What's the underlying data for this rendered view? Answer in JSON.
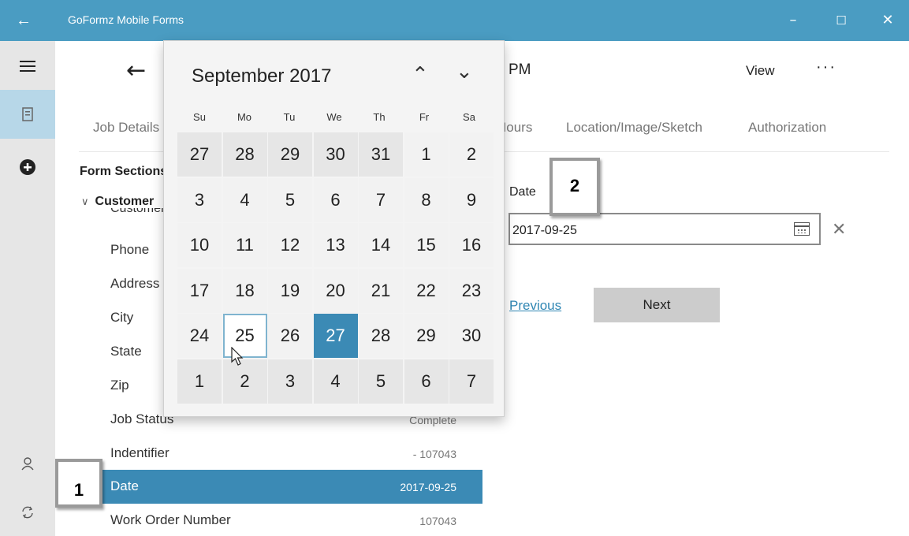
{
  "titlebar": {
    "title": "GoFormz Mobile Forms"
  },
  "header": {
    "title_partial": "PM",
    "view_label": "View",
    "more_label": "···"
  },
  "tabs": [
    "Job Details",
    "Hours",
    "Location/Image/Sketch",
    "Authorization"
  ],
  "sidebar": {
    "section_title": "Form Sections",
    "group_label": "Customer",
    "group_peek": "Customer"
  },
  "rows": [
    {
      "label": "Phone",
      "value": ""
    },
    {
      "label": "Address",
      "value": ""
    },
    {
      "label": "City",
      "value": ""
    },
    {
      "label": "State",
      "value": ""
    },
    {
      "label": "Zip",
      "value": ""
    },
    {
      "label": "Job Status",
      "value": "Complete"
    },
    {
      "label": "Indentifier",
      "value": "- 107043"
    },
    {
      "label": "Date",
      "value": "2017-09-25",
      "selected": true
    },
    {
      "label": "Work Order Number",
      "value": "107043"
    }
  ],
  "field": {
    "label": "Date",
    "value": "2017-09-25"
  },
  "buttons": {
    "previous": "Previous",
    "next": "Next"
  },
  "callouts": {
    "one": "1",
    "two": "2"
  },
  "calendar": {
    "month": "September 2017",
    "weekdays": [
      "Su",
      "Mo",
      "Tu",
      "We",
      "Th",
      "Fr",
      "Sa"
    ],
    "days": [
      {
        "d": "27",
        "out": true
      },
      {
        "d": "28",
        "out": true
      },
      {
        "d": "29",
        "out": true
      },
      {
        "d": "30",
        "out": true
      },
      {
        "d": "31",
        "out": true
      },
      {
        "d": "1"
      },
      {
        "d": "2"
      },
      {
        "d": "3"
      },
      {
        "d": "4"
      },
      {
        "d": "5"
      },
      {
        "d": "6"
      },
      {
        "d": "7"
      },
      {
        "d": "8"
      },
      {
        "d": "9"
      },
      {
        "d": "10"
      },
      {
        "d": "11"
      },
      {
        "d": "12"
      },
      {
        "d": "13"
      },
      {
        "d": "14"
      },
      {
        "d": "15"
      },
      {
        "d": "16"
      },
      {
        "d": "17"
      },
      {
        "d": "18"
      },
      {
        "d": "19"
      },
      {
        "d": "20"
      },
      {
        "d": "21"
      },
      {
        "d": "22"
      },
      {
        "d": "23"
      },
      {
        "d": "24"
      },
      {
        "d": "25",
        "hover": true
      },
      {
        "d": "26"
      },
      {
        "d": "27",
        "today": true
      },
      {
        "d": "28"
      },
      {
        "d": "29"
      },
      {
        "d": "30"
      },
      {
        "d": "1",
        "out": true
      },
      {
        "d": "2",
        "out": true
      },
      {
        "d": "3",
        "out": true
      },
      {
        "d": "4",
        "out": true
      },
      {
        "d": "5",
        "out": true
      },
      {
        "d": "6",
        "out": true
      },
      {
        "d": "7",
        "out": true
      }
    ]
  },
  "colors": {
    "titlebar": "#4a9cc2",
    "accent": "#3b8ab5",
    "link": "#2f86b3"
  },
  "icons": [
    "back-arrow-icon",
    "hamburger-icon",
    "forms-icon",
    "add-icon",
    "user-icon",
    "sync-icon",
    "calendar-icon",
    "clear-icon",
    "chevron-up-icon",
    "chevron-down-icon"
  ]
}
